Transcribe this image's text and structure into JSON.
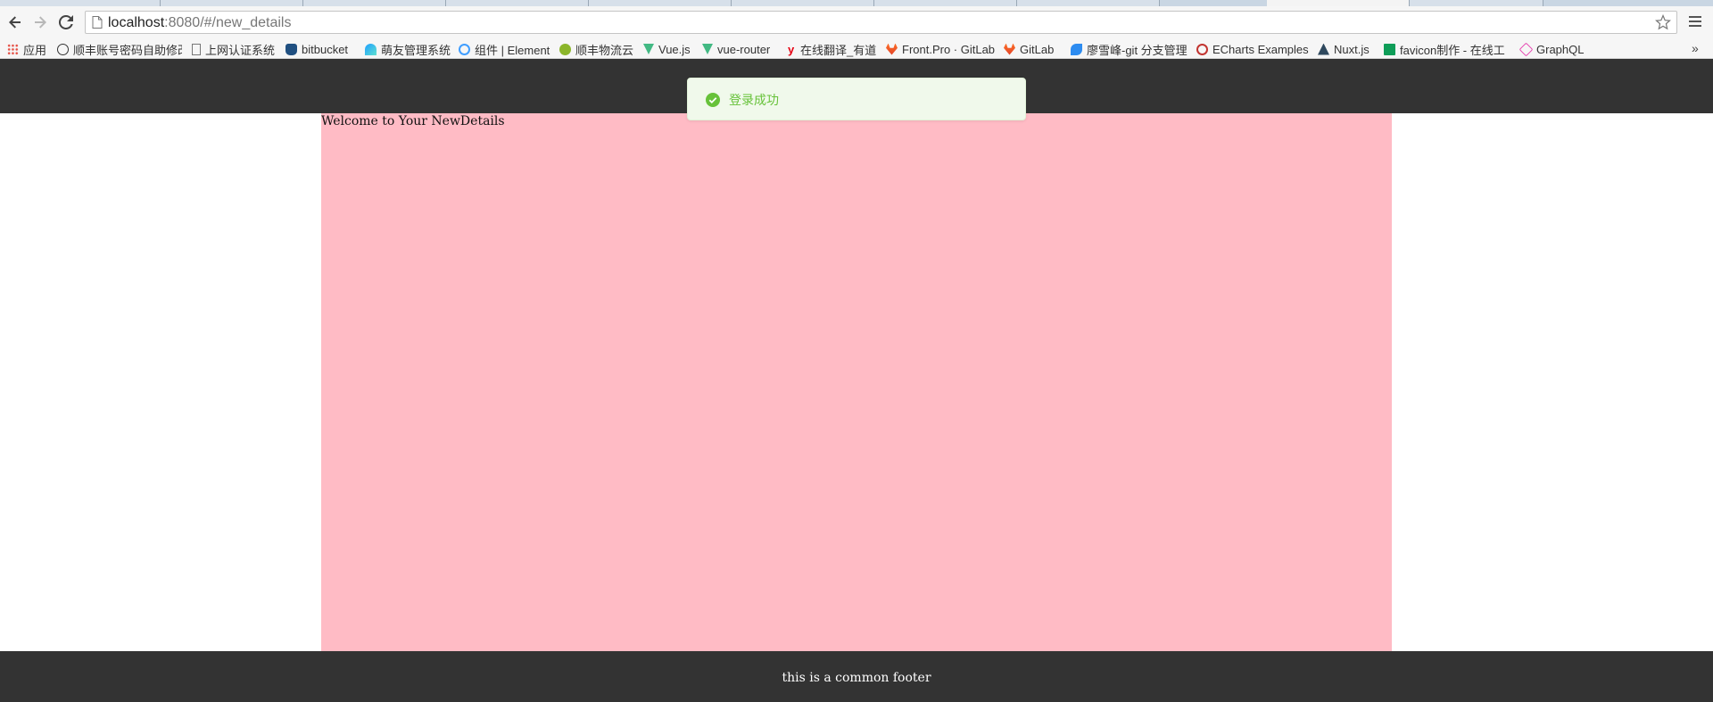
{
  "browser": {
    "url_host": "localhost",
    "url_rest": ":8080/#/new_details",
    "bookmarks": [
      {
        "label": "应用",
        "icon": "apps-grid-icon",
        "color": "#e54d42"
      },
      {
        "label": "顺丰账号密码自助修改",
        "icon": "sf-logo-icon",
        "color": "#333333"
      },
      {
        "label": "上网认证系统",
        "icon": "page-icon",
        "color": "#888888"
      },
      {
        "label": "bitbucket",
        "icon": "bitbucket-icon",
        "color": "#205081"
      },
      {
        "label": "萌友管理系统",
        "icon": "mengyou-icon",
        "color": "#1e9fff"
      },
      {
        "label": "组件 | Element",
        "icon": "element-icon",
        "color": "#409eff"
      },
      {
        "label": "顺丰物流云",
        "icon": "sf-cloud-icon",
        "color": "#8bb52a"
      },
      {
        "label": "Vue.js",
        "icon": "vue-icon",
        "color": "#42b983"
      },
      {
        "label": "vue-router",
        "icon": "vue-icon",
        "color": "#42b983"
      },
      {
        "label": "在线翻译_有道",
        "icon": "youdao-icon",
        "color": "#e60012"
      },
      {
        "label": "Front.Pro · GitLab",
        "icon": "gitlab-icon",
        "color": "#e2432a"
      },
      {
        "label": "GitLab",
        "icon": "gitlab-icon",
        "color": "#e2432a"
      },
      {
        "label": "廖雪峰-git 分支管理",
        "icon": "rocket-icon",
        "color": "#2d8cf0"
      },
      {
        "label": "ECharts Examples",
        "icon": "echarts-icon",
        "color": "#c23531"
      },
      {
        "label": "Nuxt.js",
        "icon": "nuxt-icon",
        "color": "#41b883"
      },
      {
        "label": "favicon制作 - 在线工",
        "icon": "favicon-tool-icon",
        "color": "#0f9d58"
      },
      {
        "label": "GraphQL",
        "icon": "graphql-icon",
        "color": "#e535ab"
      }
    ]
  },
  "page": {
    "welcome_text": "Welcome to Your NewDetails",
    "footer_text": "this is a common footer"
  },
  "toast": {
    "message": "登录成功",
    "type": "success",
    "color": "#67c23a"
  }
}
